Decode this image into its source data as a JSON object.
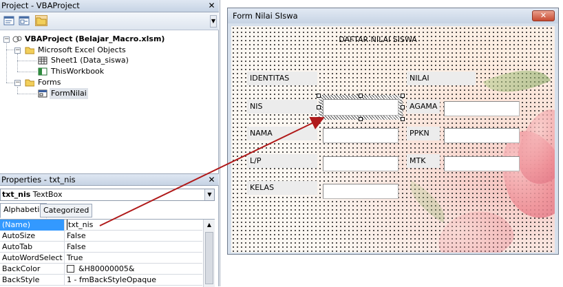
{
  "project_pane": {
    "title": "Project - VBAProject",
    "close": "✕",
    "tree": {
      "root": "VBAProject (Belajar_Macro.xlsm)",
      "excel_objects": "Microsoft Excel Objects",
      "sheet1": "Sheet1 (Data_siswa)",
      "workbook": "ThisWorkbook",
      "forms": "Forms",
      "form_nilai": "FormNilai"
    }
  },
  "properties_pane": {
    "title": "Properties - txt_nis",
    "close": "✕",
    "object_name": "txt_nis",
    "object_type": "TextBox",
    "tabs": [
      "Alphabetic",
      "Categorized"
    ],
    "rows": [
      {
        "key": "(Name)",
        "value": "txt_nis"
      },
      {
        "key": "AutoSize",
        "value": "False"
      },
      {
        "key": "AutoTab",
        "value": "False"
      },
      {
        "key": "AutoWordSelect",
        "value": "True"
      },
      {
        "key": "BackColor",
        "value": "&H80000005&"
      },
      {
        "key": "BackStyle",
        "value": "1 - fmBackStyleOpaque"
      }
    ]
  },
  "userform": {
    "title": "Form Nilai SIswa",
    "close": "✕",
    "heading": "DAFTAR NILAI SISWA",
    "labels": {
      "identitas": "IDENTITAS",
      "nilai": "NILAI",
      "nis": "NIS",
      "nama": "NAMA",
      "lp": "L/P",
      "kelas": "KELAS",
      "agama": "AGAMA",
      "ppkn": "PPKN",
      "mtk": "MTK"
    }
  },
  "colors": {
    "selection": "#3399ff",
    "arrow": "#b01a1a",
    "title_bar": "#c7d4e4"
  }
}
